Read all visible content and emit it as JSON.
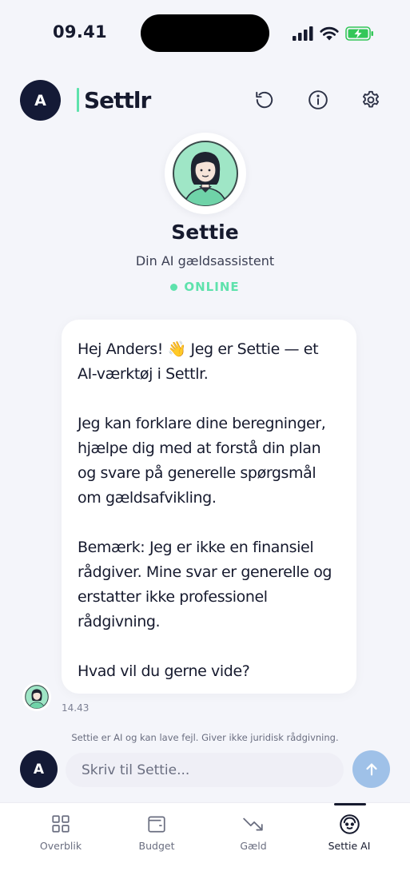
{
  "status_bar": {
    "time": "09.41"
  },
  "header": {
    "avatar_initial": "A",
    "logo": "Settlr"
  },
  "assistant": {
    "name": "Settie",
    "subtitle": "Din AI gældsassistent",
    "status": "ONLINE"
  },
  "message": {
    "paragraphs": [
      "Hej Anders! 👋 Jeg er Settie — et AI-værktøj i Settlr.",
      "Jeg kan forklare dine beregninger, hjælpe dig med at forstå din plan og svare på generelle spørgsmål om gældsafvikling.",
      "Bemærk: Jeg er ikke en finansiel rådgiver. Mine svar er generelle og erstatter ikke professionel rådgivning.",
      "Hvad vil du gerne vide?"
    ],
    "time": "14.43"
  },
  "disclaimer": "Settie er AI og kan lave fejl. Giver ikke juridisk rådgivning.",
  "composer": {
    "avatar_initial": "A",
    "placeholder": "Skriv til Settie..."
  },
  "tabs": [
    {
      "label": "Overblik",
      "icon": "grid-icon"
    },
    {
      "label": "Budget",
      "icon": "wallet-icon"
    },
    {
      "label": "Gæld",
      "icon": "trend-down-icon"
    },
    {
      "label": "Settie AI",
      "icon": "bot-face-icon"
    }
  ],
  "colors": {
    "accent": "#5ee2ac",
    "navy": "#141a36",
    "send_button": "#9fc1e8",
    "background": "#f4f5fa"
  }
}
